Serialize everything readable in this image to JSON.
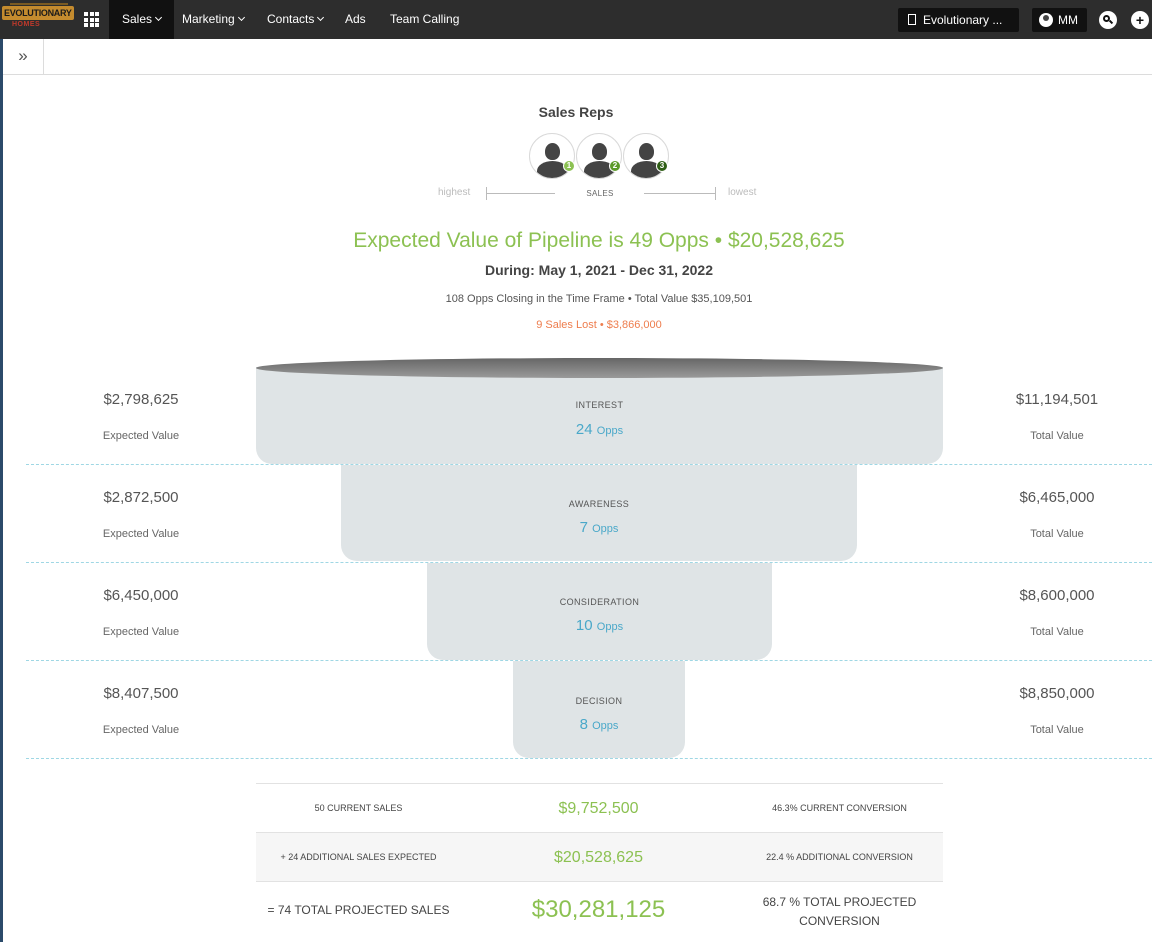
{
  "nav": {
    "logo_text": "EVOLUTIONARY",
    "logo_sub": "HOMES",
    "items": [
      {
        "label": "Sales",
        "dropdown": true,
        "active": true
      },
      {
        "label": "Marketing",
        "dropdown": true
      },
      {
        "label": "Contacts",
        "dropdown": true
      },
      {
        "label": "Ads",
        "dropdown": false
      },
      {
        "label": "Team Calling",
        "dropdown": false
      }
    ],
    "org_label": "Evolutionary ...",
    "user_initials": "MM",
    "plus_symbol": "+"
  },
  "subbar": {
    "expand_symbol": "»"
  },
  "reps": {
    "title": "Sales Reps",
    "badges": [
      "1",
      "2",
      "3"
    ],
    "badge_colors": [
      "#8cc152",
      "#5d9b2a",
      "#2e5e15"
    ],
    "scale_high": "highest",
    "scale_center": "SALES",
    "scale_low": "lowest"
  },
  "summary_header": {
    "pipeline_title": "Expected Value of Pipeline is 49 Opps • $20,528,625",
    "during": "During: May 1, 2021 - Dec 31, 2022",
    "closing": "108 Opps Closing in the Time Frame • Total Value $35,109,501",
    "lost": "9 Sales Lost • $3,866,000"
  },
  "funnel": {
    "stages": [
      {
        "name": "INTEREST",
        "count": "24",
        "unit": "Opps",
        "expected_value": "$2,798,625",
        "expected_label": "Expected Value",
        "total_value": "$11,194,501",
        "total_label": "Total Value"
      },
      {
        "name": "AWARENESS",
        "count": "7",
        "unit": "Opps",
        "expected_value": "$2,872,500",
        "expected_label": "Expected Value",
        "total_value": "$6,465,000",
        "total_label": "Total Value"
      },
      {
        "name": "CONSIDERATION",
        "count": "10",
        "unit": "Opps",
        "expected_value": "$6,450,000",
        "expected_label": "Expected Value",
        "total_value": "$8,600,000",
        "total_label": "Total Value"
      },
      {
        "name": "DECISION",
        "count": "8",
        "unit": "Opps",
        "expected_value": "$8,407,500",
        "expected_label": "Expected Value",
        "total_value": "$8,850,000",
        "total_label": "Total Value"
      }
    ]
  },
  "totals": {
    "rows": [
      {
        "label": "50 CURRENT SALES",
        "value": "$9,752,500",
        "conversion": "46.3% CURRENT CONVERSION"
      },
      {
        "label": "+ 24 ADDITIONAL SALES EXPECTED",
        "value": "$20,528,625",
        "conversion": "22.4 % ADDITIONAL CONVERSION"
      },
      {
        "label": "= 74 TOTAL PROJECTED SALES",
        "value": "$30,281,125",
        "conversion": "68.7 % TOTAL PROJECTED CONVERSION"
      }
    ]
  },
  "colors": {
    "nav_bg": "#2d2d2d",
    "accent_green": "#8cc152",
    "accent_blue": "#4aa8c9",
    "lost_orange": "#ee7d4d",
    "funnel_fill": "#dfe4e6"
  }
}
